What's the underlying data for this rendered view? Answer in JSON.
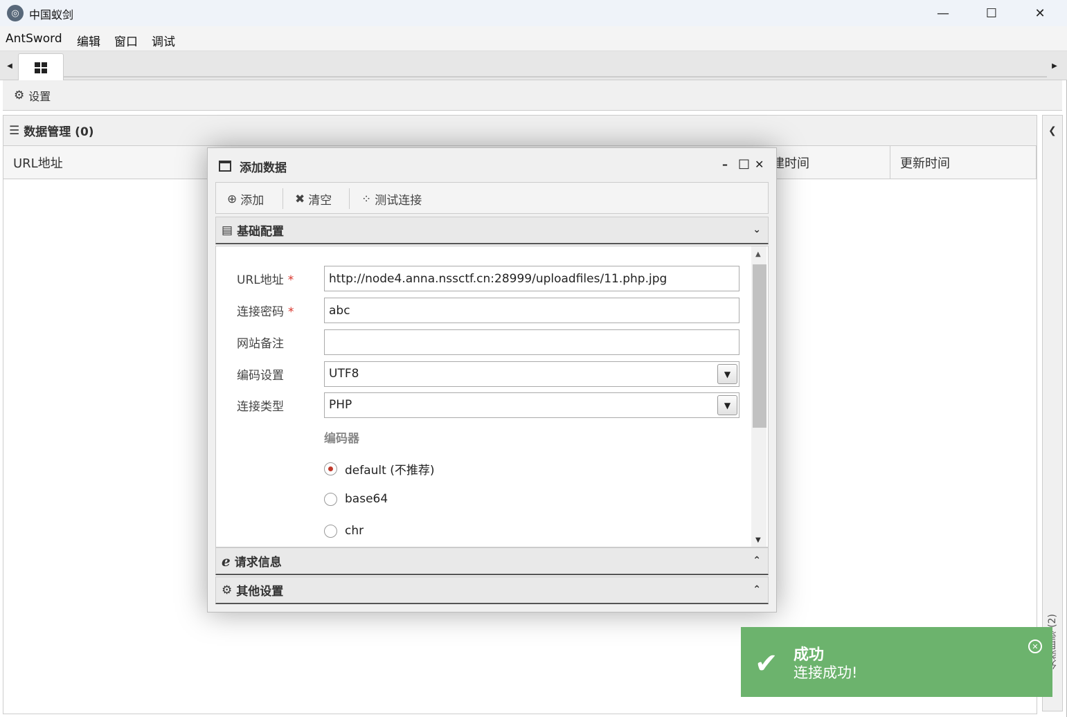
{
  "window": {
    "title": "中国蚁剑",
    "controls": {
      "minimize": "—",
      "maximize": "☐",
      "close": "✕"
    }
  },
  "menu": [
    "AntSword",
    "编辑",
    "窗口",
    "调试"
  ],
  "tabs": {
    "left_arrow": "◀",
    "right_arrow": "▶",
    "active_icon": "grid-icon"
  },
  "toolbar": {
    "settings_label": "设置"
  },
  "data_panel": {
    "title": "数据管理 (0)",
    "columns": [
      "URL地址",
      "建时间",
      "更新时间"
    ]
  },
  "sidebar": {
    "collapse_icon": "chevron-left-icon",
    "label": "分类目录 (2)"
  },
  "dialog": {
    "title": "添加数据",
    "controls": {
      "minimize": "–",
      "maximize": "□",
      "close": "✕"
    },
    "toolbar": {
      "add": "添加",
      "clear": "清空",
      "test": "测试连接"
    },
    "sections": {
      "basic": "基础配置",
      "request": "请求信息",
      "other": "其他设置"
    },
    "form": {
      "url_label": "URL地址",
      "url_value": "http://node4.anna.nssctf.cn:28999/uploadfiles/11.php.jpg",
      "password_label": "连接密码",
      "password_value": "abc",
      "note_label": "网站备注",
      "note_value": "",
      "encoding_label": "编码设置",
      "encoding_value": "UTF8",
      "type_label": "连接类型",
      "type_value": "PHP",
      "encoder_label": "编码器",
      "required_mark": "*",
      "encoders": [
        {
          "label": "default",
          "note": "(不推荐)",
          "selected": true
        },
        {
          "label": "base64",
          "selected": false
        },
        {
          "label": "chr",
          "selected": false
        }
      ]
    }
  },
  "toast": {
    "title": "成功",
    "message": "连接成功!",
    "color": "#6cb36d"
  }
}
